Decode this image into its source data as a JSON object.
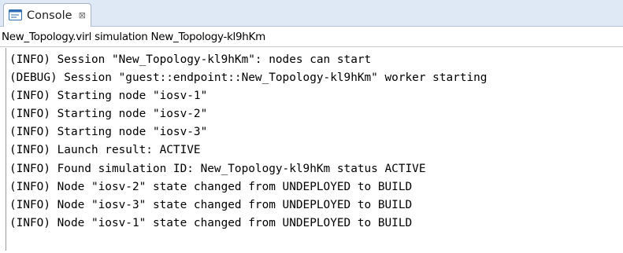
{
  "tab": {
    "title": "Console",
    "close_symbol": "⊠",
    "icon": "console-icon"
  },
  "console": {
    "description": "New_Topology.virl simulation New_Topology-kl9hKm",
    "lines": [
      "(INFO) Session \"New_Topology-kl9hKm\": nodes can start",
      "(DEBUG) Session \"guest::endpoint::New_Topology-kl9hKm\" worker starting",
      "(INFO) Starting node \"iosv-1\"",
      "(INFO) Starting node \"iosv-2\"",
      "(INFO) Starting node \"iosv-3\"",
      "(INFO) Launch result: ACTIVE",
      "(INFO) Found simulation ID: New_Topology-kl9hKm status ACTIVE",
      "(INFO) Node \"iosv-2\" state changed from UNDEPLOYED to BUILD",
      "(INFO) Node \"iosv-3\" state changed from UNDEPLOYED to BUILD",
      "(INFO) Node \"iosv-1\" state changed from UNDEPLOYED to BUILD"
    ]
  },
  "colors": {
    "tabbar_background": "#dfe8f5",
    "icon_blue": "#2f6db5",
    "text": "#000000"
  }
}
